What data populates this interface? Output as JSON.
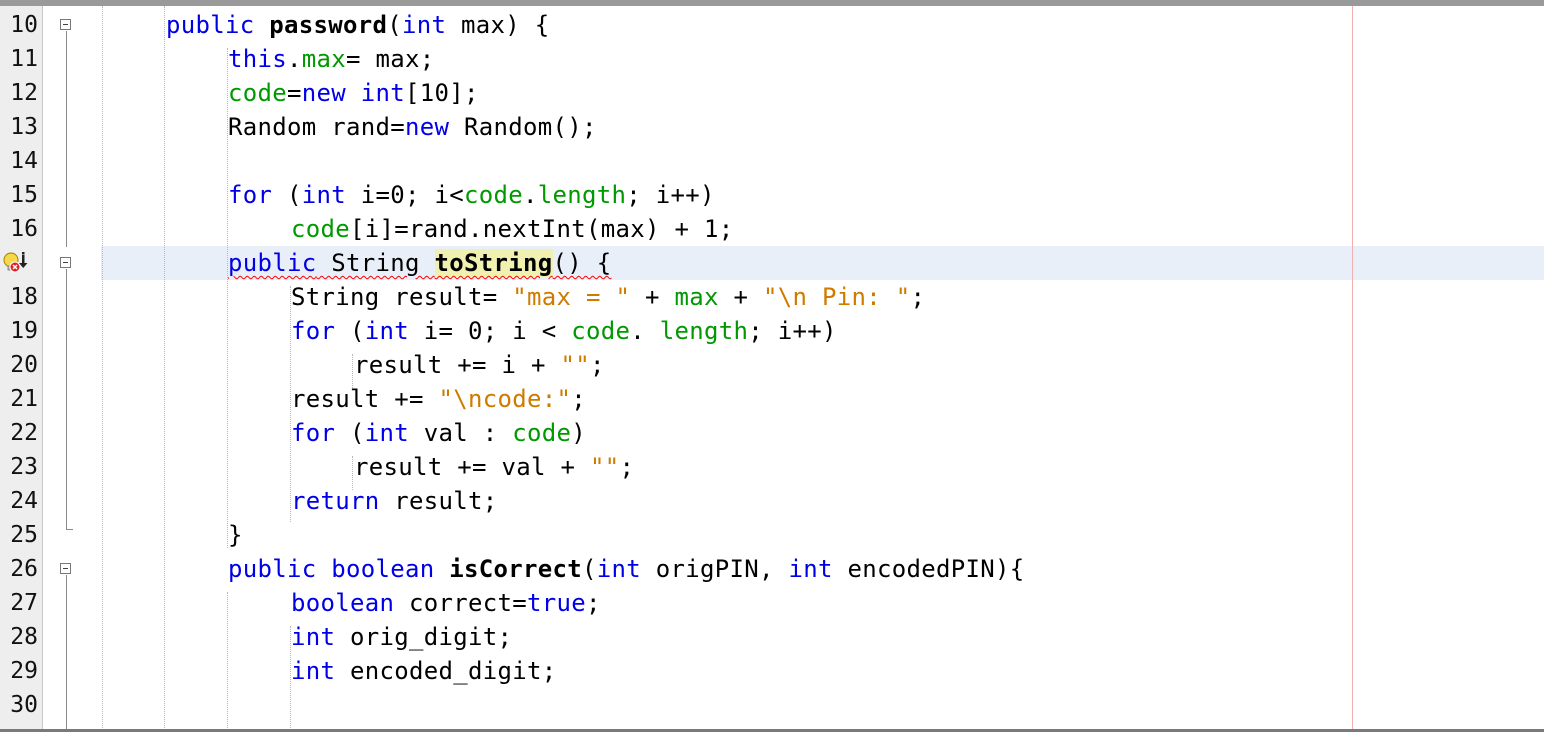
{
  "editor": {
    "lines": [
      {
        "num": "10"
      },
      {
        "num": "11"
      },
      {
        "num": "12"
      },
      {
        "num": "13"
      },
      {
        "num": "14"
      },
      {
        "num": "15"
      },
      {
        "num": "16"
      },
      {
        "num": "17"
      },
      {
        "num": "18"
      },
      {
        "num": "19"
      },
      {
        "num": "20"
      },
      {
        "num": "21"
      },
      {
        "num": "22"
      },
      {
        "num": "23"
      },
      {
        "num": "24"
      },
      {
        "num": "25"
      },
      {
        "num": "26"
      },
      {
        "num": "27"
      },
      {
        "num": "28"
      },
      {
        "num": "29"
      },
      {
        "num": "30"
      }
    ],
    "tokens": {
      "l10": [
        "public",
        " ",
        "password",
        "(",
        "int",
        " max) {"
      ],
      "l11": [
        "this",
        ".",
        "max",
        "= max;"
      ],
      "l12": [
        "code",
        "=",
        "new",
        " ",
        "int",
        "[10];"
      ],
      "l13": [
        "Random rand=",
        "new",
        " Random();"
      ],
      "l15": [
        "for",
        " (",
        "int",
        " i=0; i<",
        "code",
        ".",
        "length",
        "; i++)"
      ],
      "l16": [
        "code",
        "[i]=rand.nextInt(max) + 1;"
      ],
      "l17": [
        "public",
        " String ",
        "toString",
        "() {"
      ],
      "l18": [
        "String result= ",
        "\"max = \"",
        " + ",
        "max",
        " + ",
        "\"\\n Pin: \"",
        ";"
      ],
      "l19": [
        "for",
        " (",
        "int",
        " i= 0; i < ",
        "code",
        ". ",
        "length",
        "; i++)"
      ],
      "l20": [
        "result += i + ",
        "\"\"",
        ";"
      ],
      "l21": [
        "result += ",
        "\"\\ncode:\"",
        ";"
      ],
      "l22": [
        "for",
        " (",
        "int",
        " val : ",
        "code",
        ")"
      ],
      "l23": [
        "result += val + ",
        "\"\"",
        ";"
      ],
      "l24": [
        "return",
        " result;"
      ],
      "l25": [
        "}"
      ],
      "l26": [
        "public",
        " ",
        "boolean",
        " ",
        "isCorrect",
        "(",
        "int",
        " origPIN, ",
        "int",
        " encodedPIN){"
      ],
      "l27": [
        "boolean",
        " correct=",
        "true",
        ";"
      ],
      "l28": [
        "int",
        " orig_digit;"
      ],
      "l29": [
        "int",
        " encoded_digit;"
      ]
    }
  },
  "colors": {
    "keyword": "#0000e6",
    "field": "#009900",
    "string": "#ce7b00",
    "highlight_line": "#e9eff8",
    "occurrence_mark": "#f0f0b0",
    "error_underline": "#ff0000",
    "right_margin": "#f2b0b0"
  },
  "icons": {
    "line17": "error-hint-lightbulb-icon",
    "fold": "fold-collapse-icon"
  }
}
